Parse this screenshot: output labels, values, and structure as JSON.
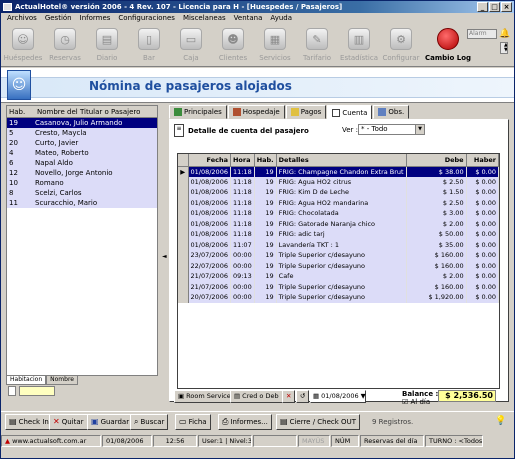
{
  "window": {
    "title": "ActualHotel® versión 2006 - 4 Rev. 107 - Licencia para H - [Huespedes / Pasajeros]"
  },
  "menu": [
    "Archivos",
    "Gestión",
    "Informes",
    "Configuraciones",
    "Miscelaneas",
    "Ventana",
    "Ayuda"
  ],
  "toolbar": [
    {
      "label": "Huéspedes",
      "icon": "guests-icon"
    },
    {
      "label": "Reservas",
      "icon": "reservations-icon"
    },
    {
      "label": "Diario",
      "icon": "journal-icon"
    },
    {
      "label": "Bar",
      "icon": "bar-icon"
    },
    {
      "label": "Caja",
      "icon": "cashbox-icon"
    },
    {
      "label": "Clientes",
      "icon": "clients-icon"
    },
    {
      "label": "Servicios",
      "icon": "services-icon"
    },
    {
      "label": "Tarifario",
      "icon": "rates-icon"
    },
    {
      "label": "Estadística",
      "icon": "statistics-icon"
    },
    {
      "label": "Configurar",
      "icon": "settings-icon"
    },
    {
      "label": "Cambio Log",
      "icon": "change-log-icon"
    }
  ],
  "alarm": {
    "label": "Alarm"
  },
  "header": {
    "title": "Nómina de pasajeros alojados"
  },
  "guests": {
    "columns": [
      "Hab.",
      "Nombre del Titular o Pasajero"
    ],
    "rows": [
      {
        "hab": "19",
        "name": "Casanova, Julio Armando"
      },
      {
        "hab": "5",
        "name": "Cresto, Maycla"
      },
      {
        "hab": "20",
        "name": "Curto, Javier"
      },
      {
        "hab": "4",
        "name": "Mateo, Roberto"
      },
      {
        "hab": "6",
        "name": "Napal Aldo"
      },
      {
        "hab": "12",
        "name": "Novello, Jorge Antonio"
      },
      {
        "hab": "10",
        "name": "Romano"
      },
      {
        "hab": "8",
        "name": "Scelzi, Carlos"
      },
      {
        "hab": "11",
        "name": "Scuracchio, Mario"
      }
    ],
    "tabs": [
      "Habitacion",
      "Nombre"
    ]
  },
  "tabs": [
    "Principales",
    "Hospedaje",
    "Pagos",
    "Cuenta",
    "Obs."
  ],
  "account": {
    "title": "Detalle de cuenta del pasajero",
    "ver_label": "Ver :",
    "ver_value": "* - Todo",
    "columns": [
      "Fecha",
      "Hora",
      "Hab.",
      "Detalles",
      "Debe",
      "Haber"
    ],
    "rows": [
      {
        "fecha": "01/08/2006",
        "hora": "11:18",
        "hab": "19",
        "det": "FRIG: Champagne Chandon Extra Brut",
        "debe": "$ 38.00",
        "haber": "$ 0.00"
      },
      {
        "fecha": "01/08/2006",
        "hora": "11:18",
        "hab": "19",
        "det": "FRIG: Agua HO2 citrus",
        "debe": "$ 2.50",
        "haber": "$ 0.00"
      },
      {
        "fecha": "01/08/2006",
        "hora": "11:18",
        "hab": "19",
        "det": "FRIG: Kim D de Leche",
        "debe": "$ 1.50",
        "haber": "$ 0.00"
      },
      {
        "fecha": "01/08/2006",
        "hora": "11:18",
        "hab": "19",
        "det": "FRIG: Agua HO2 mandarina",
        "debe": "$ 2.50",
        "haber": "$ 0.00"
      },
      {
        "fecha": "01/08/2006",
        "hora": "11:18",
        "hab": "19",
        "det": "FRIG: Chocolatada",
        "debe": "$ 3.00",
        "haber": "$ 0.00"
      },
      {
        "fecha": "01/08/2006",
        "hora": "11:18",
        "hab": "19",
        "det": "FRIG: Gatorade Naranja chico",
        "debe": "$ 2.00",
        "haber": "$ 0.00"
      },
      {
        "fecha": "01/08/2006",
        "hora": "11:18",
        "hab": "19",
        "det": "FRIG: adic tarj",
        "debe": "$ 50.00",
        "haber": "$ 0.00"
      },
      {
        "fecha": "01/08/2006",
        "hora": "11:07",
        "hab": "19",
        "det": "Lavandería TKT : 1",
        "debe": "$ 35.00",
        "haber": "$ 0.00"
      },
      {
        "fecha": "23/07/2006",
        "hora": "00:00",
        "hab": "19",
        "det": "Triple Superior c/desayuno",
        "debe": "$ 160.00",
        "haber": "$ 0.00"
      },
      {
        "fecha": "22/07/2006",
        "hora": "00:00",
        "hab": "19",
        "det": "Triple Superior c/desayuno",
        "debe": "$ 160.00",
        "haber": "$ 0.00"
      },
      {
        "fecha": "21/07/2006",
        "hora": "09:13",
        "hab": "19",
        "det": "Cafe",
        "debe": "$ 2.00",
        "haber": "$ 0.00"
      },
      {
        "fecha": "21/07/2006",
        "hora": "00:00",
        "hab": "19",
        "det": "Triple Superior c/desayuno",
        "debe": "$ 160.00",
        "haber": "$ 0.00"
      },
      {
        "fecha": "20/07/2006",
        "hora": "00:00",
        "hab": "19",
        "det": "Triple Superior c/desayuno",
        "debe": "$ 1,920.00",
        "haber": "$ 0.00"
      }
    ],
    "buttons": [
      "Room Service",
      "Cred o Deb"
    ],
    "date": "01/08/2006",
    "balance_label": "Balance :",
    "al_dia": "Al día",
    "balance": "$ 2,536.50"
  },
  "actions": [
    "Check In",
    "Quitar",
    "Guardar",
    "Buscar",
    "Ficha",
    "Informes...",
    "Cierre / Check OUT"
  ],
  "registros": "9 Registros.",
  "status": [
    "www.actualsoft.com.ar",
    "01/08/2006",
    "12:56",
    "User:1 | Nivel:3",
    "",
    "MAYÚS",
    "NÚM",
    "Reservas del día",
    "TURNO : <Todos>"
  ]
}
